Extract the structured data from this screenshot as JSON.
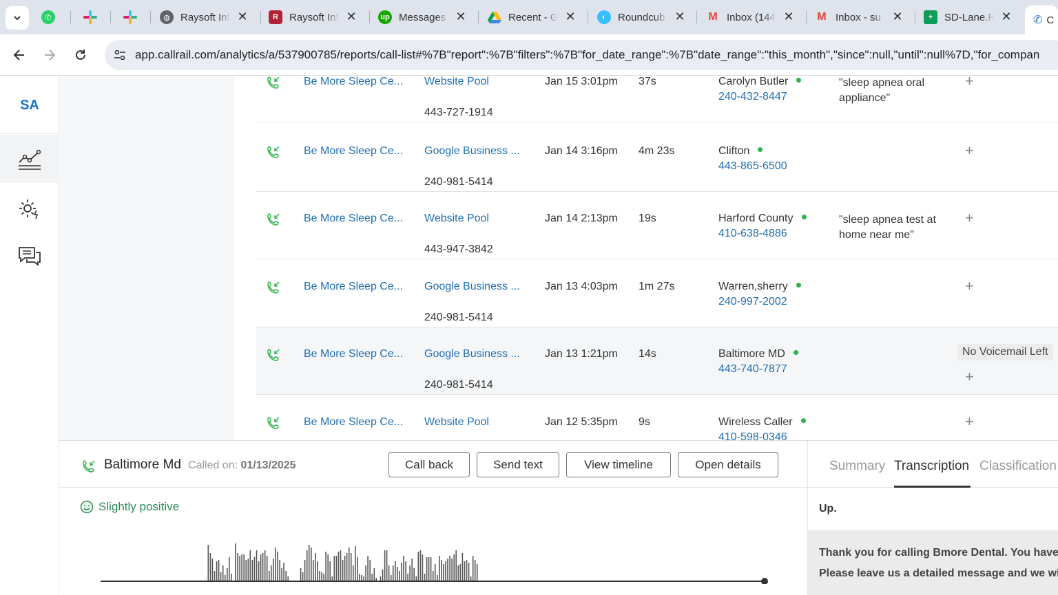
{
  "browser": {
    "tabs": [
      {
        "title": "",
        "icon": "whatsapp-icon",
        "color": "#25d366"
      },
      {
        "title": "",
        "icon": "slack-icon",
        "color": "#e01e5a"
      },
      {
        "title": "",
        "icon": "slack-icon",
        "color": "#e01e5a"
      },
      {
        "title": "Raysoft Inf",
        "icon": "globe-icon",
        "color": "#5f6368"
      },
      {
        "title": "Raysoft Inf",
        "icon": "raysoft-icon",
        "color": "#b22234"
      },
      {
        "title": "Messages",
        "icon": "upwork-icon",
        "color": "#14a800"
      },
      {
        "title": "Recent - G",
        "icon": "google-drive-icon",
        "color": "#fbbc04"
      },
      {
        "title": "Roundcub",
        "icon": "roundcube-icon",
        "color": "#37beff"
      },
      {
        "title": "Inbox (144",
        "icon": "gmail-icon",
        "color": "#ea4335"
      },
      {
        "title": "Inbox - su",
        "icon": "gmail-icon",
        "color": "#ea4335"
      },
      {
        "title": "SD-Lane.R",
        "icon": "sheets-icon",
        "color": "#0f9d58"
      },
      {
        "title": "C",
        "icon": "callrail-icon",
        "color": "#1f6fb5"
      }
    ],
    "url": "app.callrail.com/analytics/a/537900785/reports/call-list#%7B\"report\":%7B\"filters\":%7B\"for_date_range\":%7B\"date_range\":\"this_month\",\"since\":null,\"until\":null%7D,\"for_compan"
  },
  "sidebar": {
    "initials": "SA",
    "items": [
      {
        "name": "analytics-icon",
        "selected": true
      },
      {
        "name": "settings-icon",
        "selected": false
      },
      {
        "name": "messages-icon",
        "selected": false
      }
    ]
  },
  "calls": [
    {
      "company": "Be More Sleep Ce...",
      "source": "Website Pool",
      "tracking_number": "443-727-1914",
      "date": "Jan 15 3:01pm",
      "duration": "37s",
      "caller": "Carolyn Butler",
      "caller_number": "240-432-8447",
      "keywords": "\"sleep apnea oral appliance\"",
      "tag": ""
    },
    {
      "company": "Be More Sleep Ce...",
      "source": "Google Business ...",
      "tracking_number": "240-981-5414",
      "date": "Jan 14 3:16pm",
      "duration": "4m 23s",
      "caller": "Clifton",
      "caller_number": "443-865-6500",
      "keywords": "",
      "tag": ""
    },
    {
      "company": "Be More Sleep Ce...",
      "source": "Website Pool",
      "tracking_number": "443-947-3842",
      "date": "Jan 14 2:13pm",
      "duration": "19s",
      "caller": "Harford County",
      "caller_number": "410-638-4886",
      "keywords": "\"sleep apnea test at home near me\"",
      "tag": ""
    },
    {
      "company": "Be More Sleep Ce...",
      "source": "Google Business ...",
      "tracking_number": "240-981-5414",
      "date": "Jan 13 4:03pm",
      "duration": "1m 27s",
      "caller": "Warren,sherry",
      "caller_number": "240-997-2002",
      "keywords": "",
      "tag": ""
    },
    {
      "company": "Be More Sleep Ce...",
      "source": "Google Business ...",
      "tracking_number": "240-981-5414",
      "date": "Jan 13 1:21pm",
      "duration": "14s",
      "caller": "Baltimore MD",
      "caller_number": "443-740-7877",
      "keywords": "",
      "tag": "No Voicemail Left"
    },
    {
      "company": "Be More Sleep Ce...",
      "source": "Website Pool",
      "tracking_number": "",
      "date": "Jan 12 5:35pm",
      "duration": "9s",
      "caller": "Wireless Caller",
      "caller_number": "410-598-0346",
      "keywords": "",
      "tag": ""
    }
  ],
  "detail": {
    "caller_name": "Baltimore Md",
    "called_on_label": "Called on:",
    "called_on_date": "01/13/2025",
    "buttons": {
      "call_back": "Call back",
      "send_text": "Send text",
      "view_timeline": "View timeline",
      "open_details": "Open details"
    },
    "sentiment": "Slightly positive",
    "tabs": {
      "summary": "Summary",
      "transcription": "Transcription",
      "classification": "Classification"
    },
    "transcript_first": "Up.",
    "transcript_line1": "Thank you for calling Bmore Dental. You have r",
    "transcript_line2": "Please leave us a detailed message and we will"
  },
  "colors": {
    "link": "#1f6fb5",
    "online_dot": "#2db34a",
    "sentiment": "#2e8b57"
  }
}
